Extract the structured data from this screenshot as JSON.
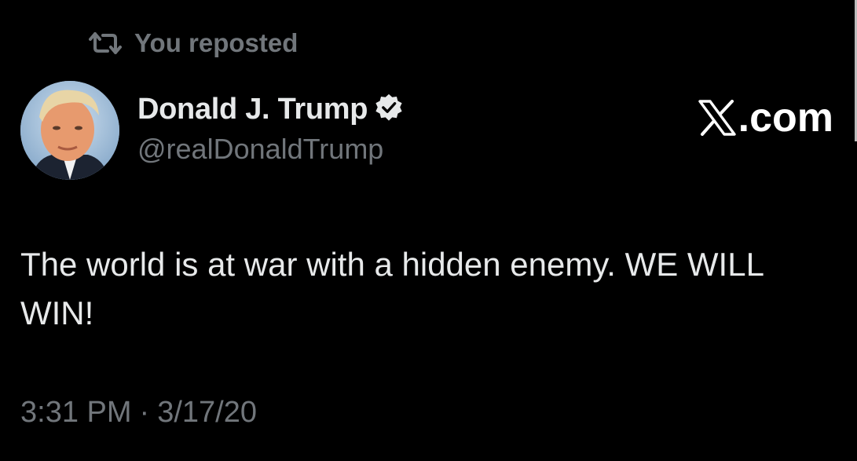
{
  "repost": {
    "icon": "repost-icon",
    "label": "You reposted"
  },
  "author": {
    "name": "Donald J. Trump",
    "handle": "@realDonaldTrump",
    "verified_icon": "verified-badge-icon",
    "avatar": "avatar"
  },
  "brand": {
    "logo_icon": "x-logo-icon",
    "suffix": ".com"
  },
  "tweet": {
    "text": "The world is at war with a hidden enemy. WE WILL WIN!"
  },
  "meta": {
    "time": "3:31 PM",
    "separator": "·",
    "date": "3/17/20"
  },
  "colors": {
    "background": "#000000",
    "primary_text": "#e7e9ea",
    "secondary_text": "#71767b",
    "verified_blue": "#1d9bf0"
  }
}
